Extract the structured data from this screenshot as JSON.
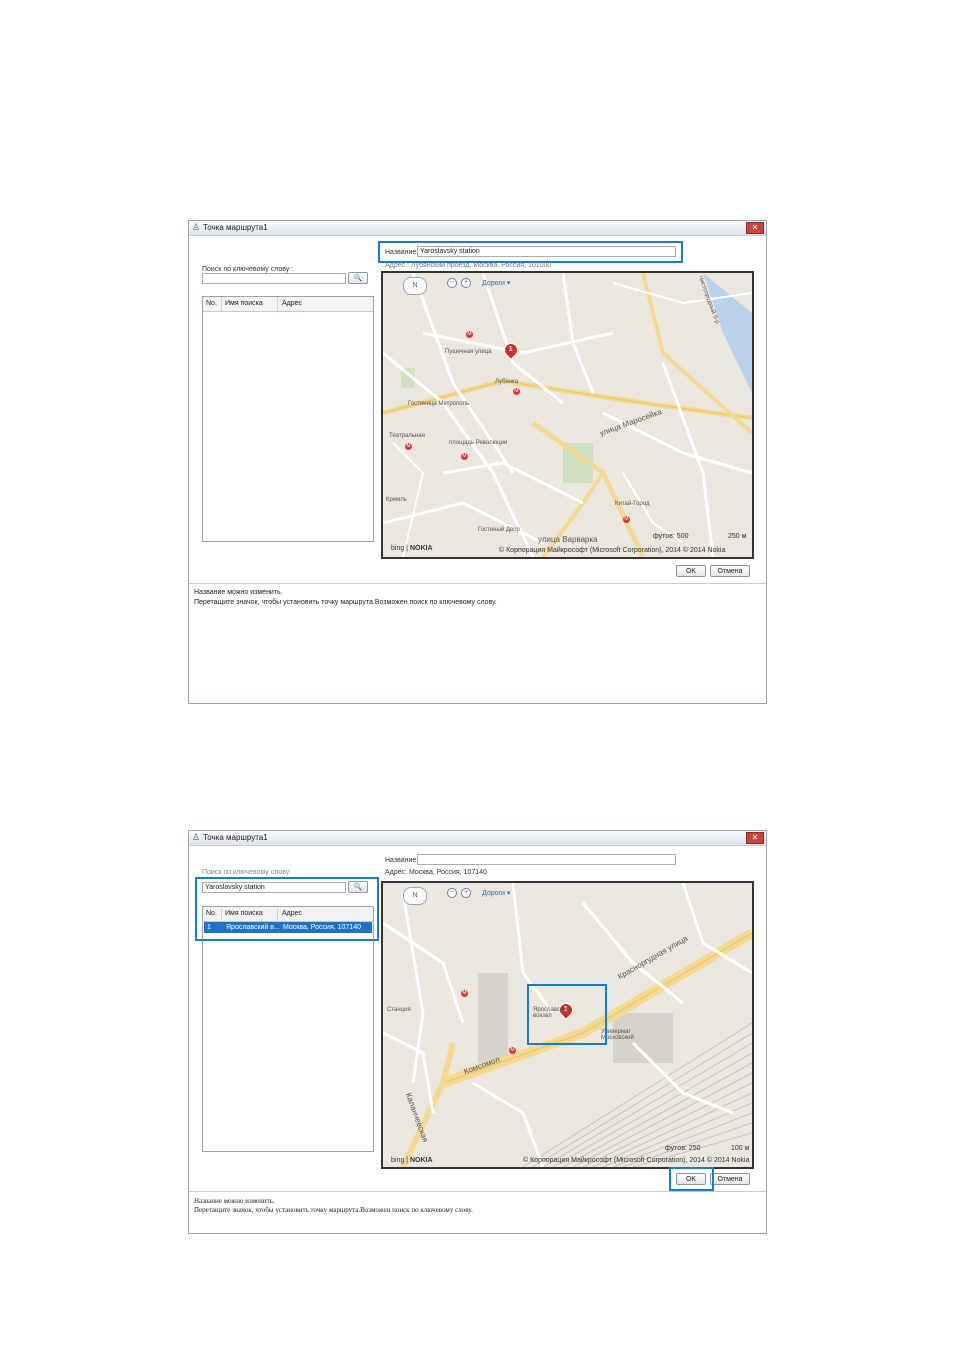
{
  "dialog1": {
    "title": "Точка маршрута1",
    "name_label": "Название:",
    "name_value": "Yaroslavsky station",
    "address_label": "Адрес :",
    "address_value": "Лубянский проезд, Москва, Россия, 101000",
    "search_label": "Поиск по ключевому слову :",
    "search_value": "",
    "columns": [
      "No.",
      "Имя поиска",
      "Адрес"
    ],
    "map": {
      "roads_label": "Дороги",
      "compass": "N",
      "street_labels": [
        "Пушечная улица",
        "улица Маросейка",
        "улица Варварка",
        "Лубянка",
        "Театральная",
        "Гостиница Метрополь",
        "площадь Революции",
        "Китай-Город",
        "Кремль",
        "Гостиный Двор",
        "Чистопрудный б-р"
      ],
      "scale_feet": "футов: 500",
      "scale_m": "250 м",
      "copyright": "© Корпорация Майкрософт (Microsoft Corporation), 2014   © 2014 Nokia",
      "bing": "bing",
      "nokia": "NOKIA"
    },
    "ok": "OK",
    "cancel": "Отмена",
    "hint1": "Название можно изменить.",
    "hint2": "Перетащите значок, чтобы установить точку маршрута.Возможен поиск по ключевому слову."
  },
  "dialog2": {
    "title": "Точка маршрута1",
    "name_label": "Название:",
    "name_value": "",
    "address_label": "Адрес:",
    "address_value": "Москва, Россия, 107140",
    "search_label": "Поиск по ключевому слову:",
    "search_value": "Yaroslavsky station",
    "columns": [
      "No.",
      "Имя поиска",
      "Адрес"
    ],
    "rows": [
      {
        "no": "1",
        "name": "Ярославский в...",
        "address": "Москва, Россия, 107140"
      }
    ],
    "map": {
      "roads_label": "Дороги",
      "compass": "N",
      "street_labels": [
        "Красноprудная улица",
        "Комсомол",
        "Станция",
        "Ярославский вокзал",
        "Универмаг Московский",
        "Каланчевская"
      ],
      "scale_feet": "футов: 250",
      "scale_m": "100 м",
      "copyright": "© Корпорация Майкрософт (Microsoft Corporation), 2014   © 2014 Nokia",
      "bing": "bing",
      "nokia": "NOKIA"
    },
    "ok": "OK",
    "cancel": "Отмена",
    "hint1": "Название можно изменить.",
    "hint2": "Перетащите значок, чтобы установить точку маршрута.Возможен поиск по ключевому слову."
  },
  "icons": {
    "search": "search-icon",
    "close": "close-icon",
    "app": "route-point-icon",
    "zoom_in": "zoom-in-icon",
    "zoom_out": "zoom-out-icon",
    "marker": "route-marker-icon",
    "metro": "metro-icon"
  },
  "colors": {
    "highlight": "#1a7bc6",
    "selection": "#1e73c8",
    "marker": "#c8302a"
  },
  "marker_number": "1"
}
